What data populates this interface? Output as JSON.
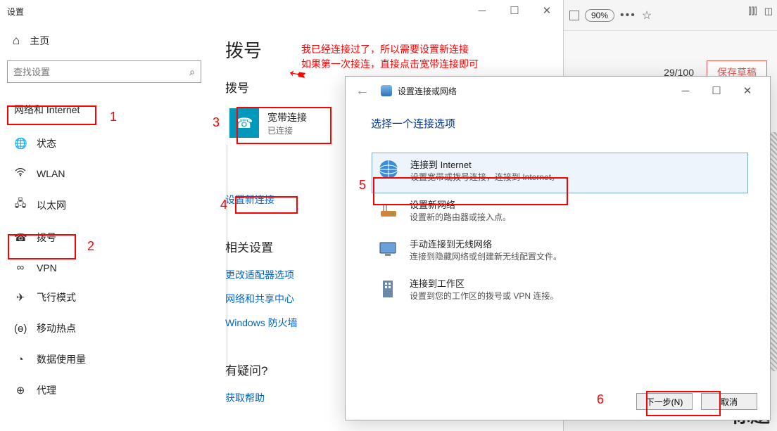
{
  "settings": {
    "window_title": "设置",
    "home": "主页",
    "search_placeholder": "查找设置",
    "category": "网络和 Internet",
    "nav": [
      {
        "icon": "status",
        "label": "状态"
      },
      {
        "icon": "wifi",
        "label": "WLAN"
      },
      {
        "icon": "eth",
        "label": "以太网"
      },
      {
        "icon": "dial",
        "label": "拨号"
      },
      {
        "icon": "vpn",
        "label": "VPN"
      },
      {
        "icon": "airplane",
        "label": "飞行模式"
      },
      {
        "icon": "hotspot",
        "label": "移动热点"
      },
      {
        "icon": "data",
        "label": "数据使用量"
      },
      {
        "icon": "proxy",
        "label": "代理"
      }
    ]
  },
  "content": {
    "page_title": "拨号",
    "section": "拨号",
    "connection": {
      "name": "宽带连接",
      "status": "已连接"
    },
    "new_conn": "设置新连接",
    "related_heading": "相关设置",
    "related_links": [
      "更改适配器选项",
      "网络和共享中心",
      "Windows 防火墙"
    ],
    "help_heading": "有疑问?",
    "help_link": "获取帮助"
  },
  "annotations": {
    "note_line1": "我已经连接过了，所以需要设置新连接",
    "note_line2": "如果第一次接连，直接点击宽带连接即可",
    "n1": "1",
    "n2": "2",
    "n3": "3",
    "n4": "4",
    "n5": "5",
    "n6": "6"
  },
  "dialog": {
    "header": "设置连接或网络",
    "heading": "选择一个连接选项",
    "options": [
      {
        "title": "连接到 Internet",
        "desc": "设置宽带或拨号连接，连接到 Internet。"
      },
      {
        "title": "设置新网络",
        "desc": "设置新的路由器或接入点。"
      },
      {
        "title": "手动连接到无线网络",
        "desc": "连接到隐藏网络或创建新无线配置文件。"
      },
      {
        "title": "连接到工作区",
        "desc": "设置到您的工作区的拨号或 VPN 连接。"
      }
    ],
    "next": "下一步(N)",
    "cancel": "取消"
  },
  "browser": {
    "zoom": "90%",
    "counter": "29/100",
    "save_draft": "保存草稿",
    "cut_text": "标题"
  }
}
